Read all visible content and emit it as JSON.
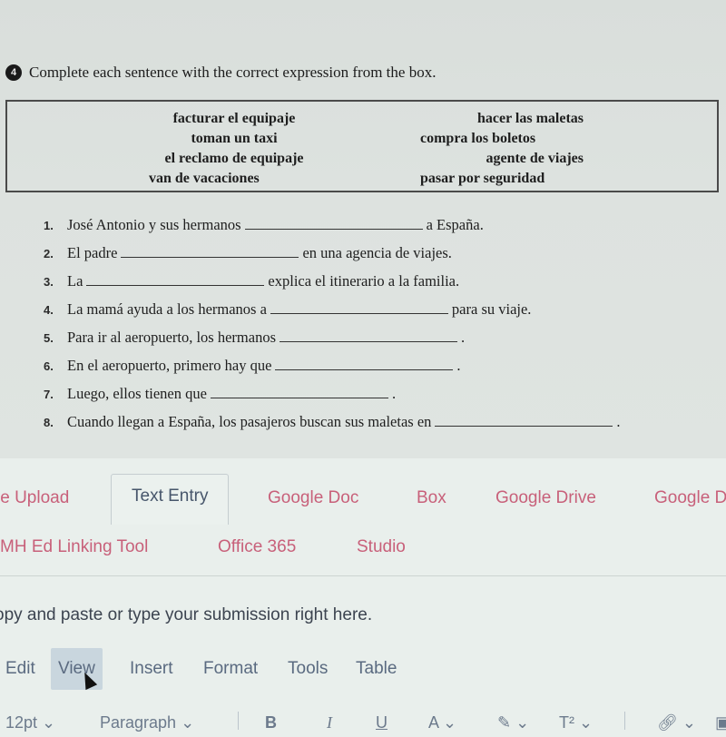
{
  "exercise": {
    "number": "4",
    "instruction": "Complete each sentence with the correct expression from the box.",
    "box_left": [
      "facturar el equipaje",
      "toman un taxi",
      "el reclamo de equipaje",
      "van de vacaciones"
    ],
    "box_right": [
      "hacer las maletas",
      "compra los boletos",
      "agente de viajes",
      "pasar por seguridad"
    ],
    "items": [
      {
        "n": "1.",
        "before": "José Antonio y sus hermanos",
        "after": "a España."
      },
      {
        "n": "2.",
        "before": "El padre",
        "after": "en una agencia de viajes."
      },
      {
        "n": "3.",
        "before": "La",
        "after": "explica el itinerario a la familia."
      },
      {
        "n": "4.",
        "before": "La mamá ayuda a los hermanos a",
        "after": "para su viaje."
      },
      {
        "n": "5.",
        "before": "Para ir al aeropuerto, los hermanos",
        "after": "."
      },
      {
        "n": "6.",
        "before": "En el aeropuerto, primero hay que",
        "after": "."
      },
      {
        "n": "7.",
        "before": "Luego, ellos tienen que",
        "after": "."
      },
      {
        "n": "8.",
        "before": "Cuando llegan a España, los pasajeros buscan sus maletas en",
        "after": "."
      }
    ]
  },
  "submission_tabs": {
    "row1": [
      "le Upload",
      "Text Entry",
      "Google Doc",
      "Box",
      "Google Drive",
      "Google D"
    ],
    "row2": [
      "MH Ed Linking Tool",
      "Office 365",
      "Studio"
    ],
    "active": "Text Entry"
  },
  "editor": {
    "hint": "opy and paste or type your submission right here.",
    "menu": [
      "Edit",
      "View",
      "Insert",
      "Format",
      "Tools",
      "Table"
    ],
    "hovered_menu": "View",
    "toolbar": {
      "font_size": "12pt",
      "block_format": "Paragraph",
      "bold": "B",
      "italic": "I",
      "underline": "U",
      "text_color": "A",
      "highlight": "✎",
      "superscript": "T²"
    }
  }
}
